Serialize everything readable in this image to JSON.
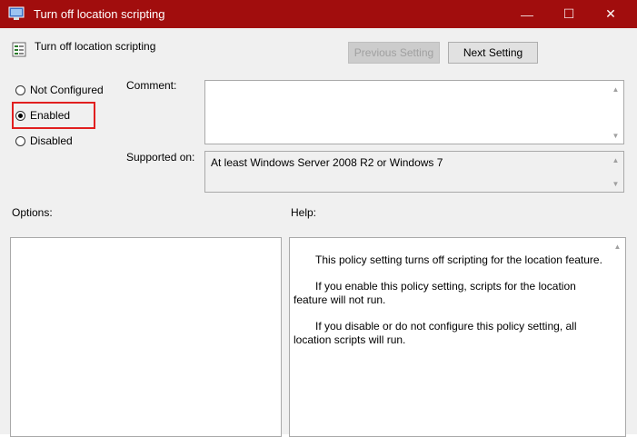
{
  "window": {
    "title": "Turn off location scripting",
    "minimize_glyph": "—",
    "maximize_glyph": "☐",
    "close_glyph": "✕"
  },
  "header": {
    "policy_name": "Turn off location scripting",
    "prev_label": "Previous Setting",
    "next_label": "Next Setting"
  },
  "state": {
    "options": [
      {
        "label": "Not Configured",
        "checked": false
      },
      {
        "label": "Enabled",
        "checked": true
      },
      {
        "label": "Disabled",
        "checked": false
      }
    ]
  },
  "comment": {
    "label": "Comment:",
    "value": ""
  },
  "supported": {
    "label": "Supported on:",
    "value": "At least Windows Server 2008 R2 or Windows 7"
  },
  "options_panel": {
    "label": "Options:"
  },
  "help_panel": {
    "label": "Help:",
    "paragraphs": [
      "This policy setting turns off scripting for the location feature.",
      "If you enable this policy setting, scripts for the location feature will not run.",
      "If you disable or do not configure this policy setting, all location scripts will run."
    ]
  },
  "colors": {
    "titlebar": "#a10d0d",
    "highlight": "#e11f1f"
  },
  "icons": {
    "app": "group-policy-icon",
    "policy": "policy-setting-icon"
  }
}
